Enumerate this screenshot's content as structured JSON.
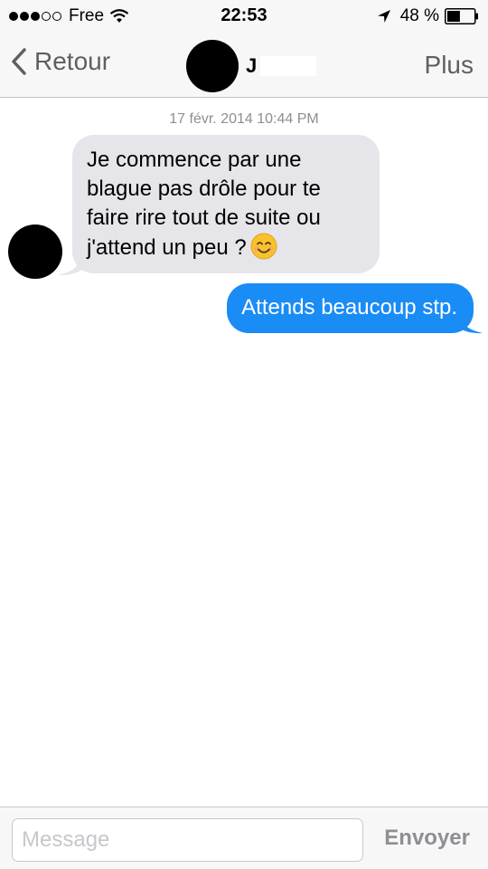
{
  "status_bar": {
    "carrier": "Free",
    "time": "22:53",
    "battery_percent": "48 %",
    "battery_level": 0.48,
    "signal_bars_filled": 3,
    "signal_bars_total": 5
  },
  "nav": {
    "back_label": "Retour",
    "contact_initial": "J",
    "more_label": "Plus"
  },
  "conversation": {
    "timestamp": "17 févr. 2014 10:44 PM",
    "messages": [
      {
        "direction": "incoming",
        "text": "Je commence par une blague pas drôle pour te faire rire tout de suite ou j'attend un peu ?",
        "emoji": "smiling-face-icon"
      },
      {
        "direction": "outgoing",
        "text": "Attends beaucoup stp."
      }
    ]
  },
  "input": {
    "placeholder": "Message",
    "value": "",
    "send_label": "Envoyer"
  },
  "colors": {
    "outgoing_bubble": "#1a8cf5",
    "incoming_bubble": "#e5e5ea",
    "nav_text": "#5f5f5f"
  }
}
